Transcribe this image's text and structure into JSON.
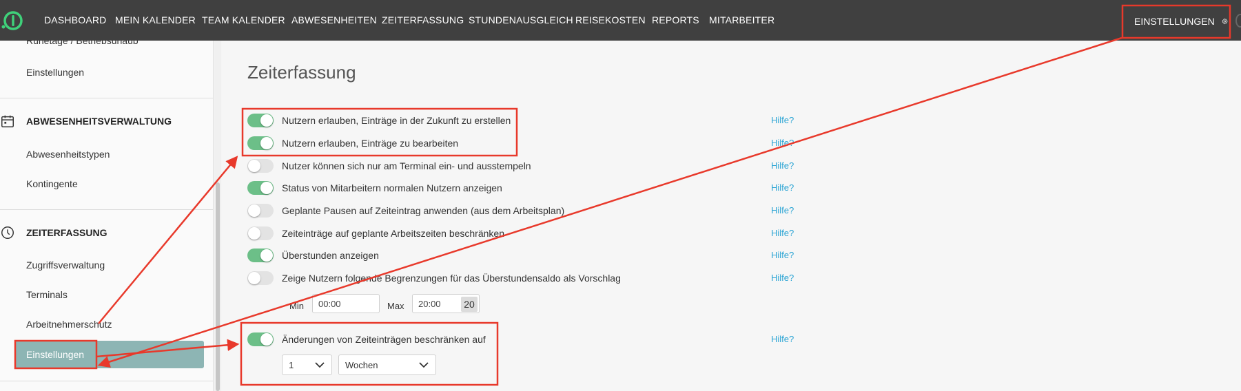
{
  "nav": {
    "items": [
      "DASHBOARD",
      "MEIN KALENDER",
      "TEAM KALENDER",
      "ABWESENHEITEN",
      "ZEITERFASSUNG",
      "STUNDENAUSGLEICH",
      "REISEKOSTEN",
      "REPORTS",
      "MITARBEITER"
    ],
    "settings_label": "EINSTELLUNGEN"
  },
  "sidebar": {
    "partial_top_item": "Ruhetage / Betriebsurlaub",
    "top_settings": "Einstellungen",
    "section_absence": {
      "title": "ABWESENHEITSVERWALTUNG",
      "items": [
        "Abwesenheitstypen",
        "Kontingente"
      ]
    },
    "section_time": {
      "title": "ZEITERFASSUNG",
      "items": [
        "Zugriffsverwaltung",
        "Terminals",
        "Arbeitnehmerschutz"
      ],
      "active_item": "Einstellungen"
    }
  },
  "main": {
    "title": "Zeiterfassung",
    "help_label": "Hilfe?",
    "settings": [
      {
        "label": "Nutzern erlauben, Einträge in der Zukunft zu erstellen",
        "on": true
      },
      {
        "label": "Nutzern erlauben, Einträge zu bearbeiten",
        "on": true
      },
      {
        "label": "Nutzer können sich nur am Terminal ein- und ausstempeln",
        "on": false
      },
      {
        "label": "Status von Mitarbeitern normalen Nutzern anzeigen",
        "on": true
      },
      {
        "label": "Geplante Pausen auf Zeiteintrag anwenden (aus dem Arbeitsplan)",
        "on": false
      },
      {
        "label": "Zeiteinträge auf geplante Arbeitszeiten beschränken",
        "on": false
      },
      {
        "label": "Überstunden anzeigen",
        "on": true
      },
      {
        "label": "Zeige Nutzern folgende Begrenzungen für das Überstundensaldo als Vorschlag",
        "on": false
      }
    ],
    "limits": {
      "min_label": "Min",
      "min_value": "00:00",
      "max_label": "Max",
      "max_value": "20:00",
      "max_tag": "20"
    },
    "restrict": {
      "label": "Änderungen von Zeiteinträgen beschränken auf",
      "on": true,
      "count_value": "1",
      "unit_value": "Wochen"
    }
  },
  "colors": {
    "topbar": "#404040",
    "toggle_on": "#6cbf88",
    "active_sidebar": "#8db5b4",
    "help_link": "#2aa4d4",
    "annotation": "#e8392b"
  }
}
